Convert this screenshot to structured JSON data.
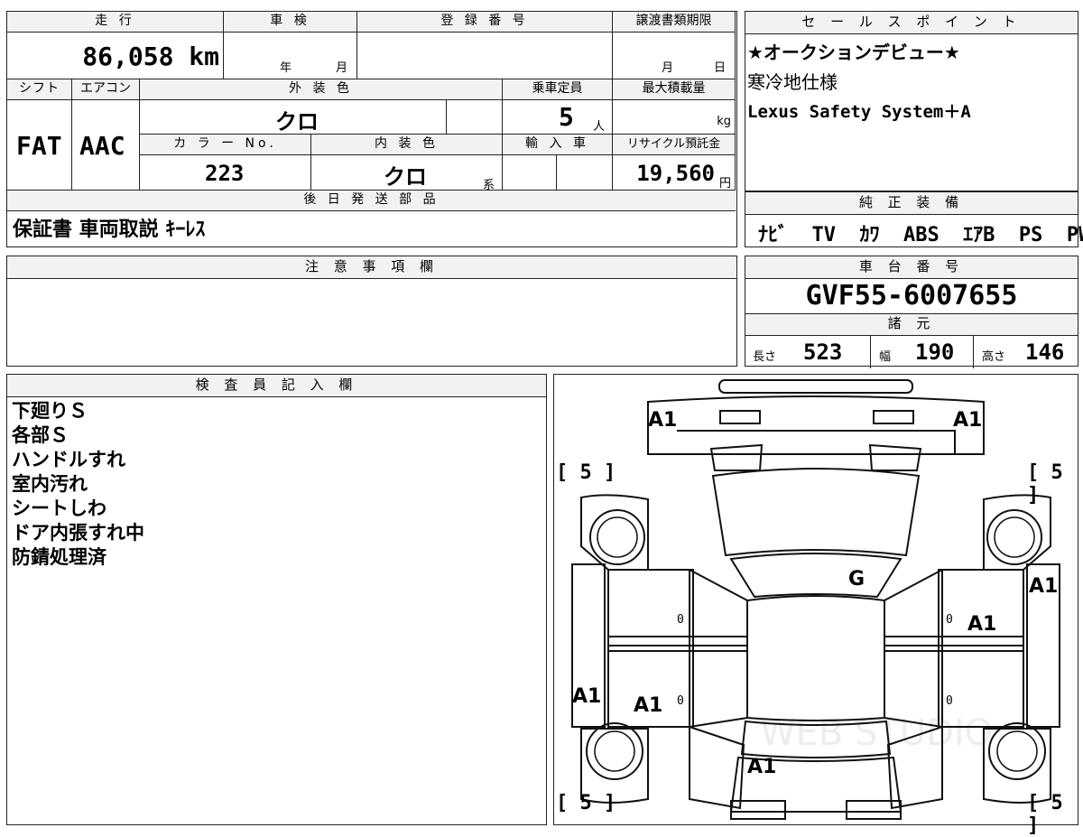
{
  "top_table": {
    "mileage_header": "走 行",
    "mileage_value": "86,058 km",
    "inspection_header": "車 検",
    "inspection_year": "年",
    "inspection_month": "月",
    "registration_header": "登 録 番 号",
    "transfer_header": "譲渡書類期限",
    "transfer_month": "月",
    "transfer_day": "日",
    "shift_header": "シフト",
    "shift_value": "FAT",
    "aircon_header": "エアコン",
    "aircon_value": "AAC",
    "exterior_header": "外 装 色",
    "exterior_value": "クロ",
    "capacity_header": "乗車定員",
    "capacity_value": "5",
    "capacity_unit": "人",
    "maxload_header": "最大積載量",
    "maxload_unit": "kg",
    "colorno_header": "カ ラ ー No.",
    "colorno_value": "223",
    "interior_header": "内 装 色",
    "interior_value": "クロ",
    "interior_suffix": "系",
    "import_header": "輸 入 車",
    "recycle_header": "リサイクル預託金",
    "recycle_value": "19,560",
    "recycle_unit": "円",
    "later_parts_header": "後 日 発 送 部 品",
    "later_parts_value": "保証書 車両取説 ｷｰﾚｽ"
  },
  "sales_points": {
    "header": "セ ー ル ス ポ イ ン ト",
    "lines": [
      "★オークションデビュー★",
      "寒冷地仕様",
      "Lexus Safety System＋A"
    ]
  },
  "equipment": {
    "header": "純 正 装 備",
    "value": "ﾅﾋﾞ  TV  ｶﾜ  ABS  ｴｱB  PS  PW"
  },
  "notes": {
    "header": "注 意 事 項 欄"
  },
  "chassis": {
    "header": "車 台 番 号",
    "value": "GVF55-6007655"
  },
  "specs": {
    "header": "諸 元",
    "length_label": "長さ",
    "length_value": "523",
    "width_label": "幅",
    "width_value": "190",
    "height_label": "高さ",
    "height_value": "146"
  },
  "inspector": {
    "header": "検 査 員 記 入 欄",
    "lines": [
      "下廻りＳ",
      "各部Ｓ",
      "ハンドルすれ",
      "室内汚れ",
      "シートしわ",
      "ドア内張すれ中",
      "防錆処理済"
    ]
  },
  "diagram": {
    "marks": {
      "front_left": "A1",
      "front_right": "A1",
      "windshield": "G",
      "right_front_fender": "A1",
      "right_front_door": "A1",
      "left_rear_fender": "A1",
      "left_rear_door": "A1",
      "rear": "A1"
    },
    "tire_fl": "[ 5 ]",
    "tire_fr": "[ 5 ]",
    "tire_rl": "[ 5 ]",
    "tire_rr": "[ 5 ]",
    "zero1": "0",
    "zero2": "0",
    "zero3": "0",
    "zero4": "0",
    "watermark": "WEB STUDIO"
  }
}
